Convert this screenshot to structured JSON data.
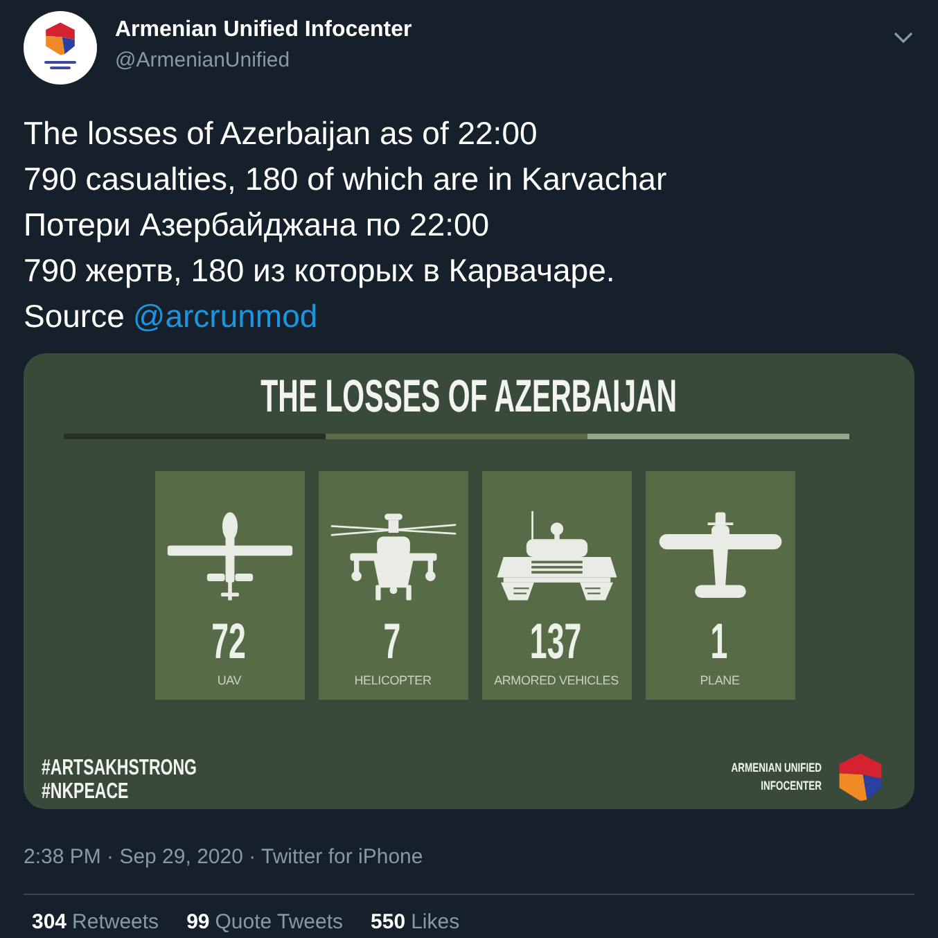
{
  "author": {
    "name": "Armenian Unified Infocenter",
    "handle": "@ArmenianUnified"
  },
  "tweet_lines": [
    "The losses of Azerbaijan as of 22:00",
    "790 casualties, 180 of which are in Karvachar",
    "Потери Азербайджана по 22:00",
    "790 жертв, 180 из которых в Карвачаре."
  ],
  "source": {
    "label": "Source",
    "mention": "@arcrunmod"
  },
  "infographic": {
    "title": "THE LOSSES OF AZERBAIJAN",
    "items": [
      {
        "kind": "uav",
        "count": "72",
        "label": "UAV"
      },
      {
        "kind": "helicopter",
        "count": "7",
        "label": "HELICOPTER"
      },
      {
        "kind": "armored",
        "count": "137",
        "label": "ARMORED VEHICLES"
      },
      {
        "kind": "plane",
        "count": "1",
        "label": "PLANE"
      }
    ],
    "hashtags": [
      "#ARTSAKHSTRONG",
      "#NKPEACE"
    ],
    "brand_lines": [
      "ARMENIAN UNIFIED",
      "INFOCENTER"
    ]
  },
  "timestamp": "2:38 PM · Sep 29, 2020 · Twitter for iPhone",
  "stats": [
    {
      "count": "304",
      "label": "Retweets"
    },
    {
      "count": "99",
      "label": "Quote Tweets"
    },
    {
      "count": "550",
      "label": "Likes"
    }
  ]
}
